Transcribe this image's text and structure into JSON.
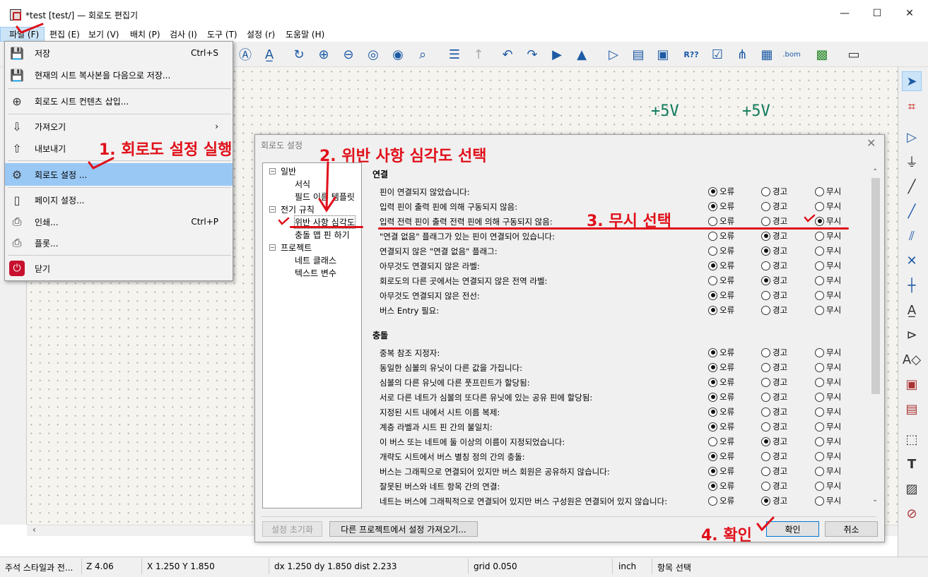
{
  "window": {
    "title": "*test [test/] — 회로도 편집기",
    "controls": {
      "minimize": "—",
      "maximize": "☐",
      "close": "✕"
    }
  },
  "menubar": [
    "파일 (F)",
    "편집 (E)",
    "보기 (V)",
    "배치 (P)",
    "검사 (I)",
    "도구 (T)",
    "설정 (r)",
    "도움말 (H)"
  ],
  "file_menu": {
    "items": [
      {
        "label": "저장",
        "shortcut": "Ctrl+S",
        "icon": "save-icon"
      },
      {
        "label": "현재의 시트 복사본을 다음으로 저장...",
        "icon": "save-copy-icon"
      },
      {
        "label": "회로도 시트 컨텐츠 삽입...",
        "icon": "insert-sheet-icon"
      },
      {
        "label": "가져오기",
        "submenu": "›",
        "icon": "import-icon"
      },
      {
        "label": "내보내기",
        "icon": "export-icon"
      },
      {
        "label": "회로도 설정 ...",
        "icon": "schematic-setup-icon",
        "highlighted": true
      },
      {
        "label": "페이지 설정...",
        "icon": "page-setup-icon"
      },
      {
        "label": "인쇄...",
        "shortcut": "Ctrl+P",
        "icon": "print-icon"
      },
      {
        "label": "플롯...",
        "icon": "plot-icon"
      },
      {
        "label": "닫기",
        "icon": "power-icon"
      }
    ]
  },
  "canvas": {
    "power_labels": [
      "+5V",
      "+5V"
    ]
  },
  "dialog": {
    "title": "회로도 설정",
    "tree": [
      {
        "label": "일반",
        "expander": "−",
        "level": 0
      },
      {
        "label": "서식",
        "level": 1
      },
      {
        "label": "필드 이름 템플릿",
        "level": 1
      },
      {
        "label": "전기 규칙",
        "expander": "−",
        "level": 0
      },
      {
        "label": "위반 사항 심각도",
        "level": 1,
        "selected": true
      },
      {
        "label": "충돌 맵 핀 하기",
        "level": 1
      },
      {
        "label": "프로젝트",
        "expander": "−",
        "level": 0
      },
      {
        "label": "네트 클래스",
        "level": 1
      },
      {
        "label": "텍스트 변수",
        "level": 1
      }
    ],
    "option_labels": {
      "error": "오류",
      "warning": "경고",
      "ignore": "무시"
    },
    "sections": [
      {
        "title": "연결",
        "rows": [
          {
            "label": "핀이 연결되지 않았습니다:",
            "selected": "error"
          },
          {
            "label": "입력 핀이 출력 핀에 의해 구동되지 않음:",
            "selected": "error"
          },
          {
            "label": "입력 전력 핀이 출력 전력 핀에 의해 구동되지 않음:",
            "selected": "ignore"
          },
          {
            "label": "\"연결 없음\" 플래그가 있는 핀이 연결되어 있습니다:",
            "selected": "warning"
          },
          {
            "label": "연결되지 않은 \"연결 없음\" 플래그:",
            "selected": "warning"
          },
          {
            "label": "아무것도 연결되지 않은 라벨:",
            "selected": "error"
          },
          {
            "label": "회로도의 다른 곳에서는 연결되지 않은 전역 라벨:",
            "selected": "warning"
          },
          {
            "label": "아무것도 연결되지 않은 전선:",
            "selected": "error"
          },
          {
            "label": "버스 Entry 필요:",
            "selected": "error"
          }
        ]
      },
      {
        "title": "충돌",
        "rows": [
          {
            "label": "중복 참조 지정자:",
            "selected": "error"
          },
          {
            "label": "동일한 심볼의 유닛이 다른 값을 가집니다:",
            "selected": "error"
          },
          {
            "label": "심볼의 다른 유닛에 다른 풋프린트가 할당됨:",
            "selected": "error"
          },
          {
            "label": "서로 다른 네트가 심볼의 또다른 유닛에 있는 공유 핀에 할당됨:",
            "selected": "error"
          },
          {
            "label": "지정된 시트 내에서 시트 이름 복제:",
            "selected": "error"
          },
          {
            "label": "계층 라벨과 시트 핀 간의 불일치:",
            "selected": "error"
          },
          {
            "label": "이 버스 또는 네트에 둘 이상의 이름이 지정되었습니다:",
            "selected": "warning"
          },
          {
            "label": "개략도 시트에서 버스 별칭 정의 간의 충돌:",
            "selected": "error"
          },
          {
            "label": "버스는 그래픽으로 연결되어 있지만 버스 회원은 공유하지 않습니다:",
            "selected": "error"
          },
          {
            "label": "잘못된 버스와 네트 항목 간의 연결:",
            "selected": "error"
          },
          {
            "label": "네트는 버스에 그래픽적으로 연결되어 있지만 버스 구성원은 연결되어 있지 않습니다:",
            "selected": "warning"
          }
        ]
      }
    ],
    "buttons": {
      "reset": "설정 초기화",
      "import": "다른 프로젝트에서 설정 가져오기...",
      "ok": "확인",
      "cancel": "취소"
    }
  },
  "annotations": {
    "step1": "1. 회로도 설정 실행",
    "step2": "2. 위반 사항 심각도 선택",
    "step3": "3. 무시 선택",
    "step4": "4. 확인"
  },
  "statusbar": {
    "hint": "주석 스타일과 전...",
    "zoom": "Z 4.06",
    "coords": "X 1.250  Y 1.850",
    "delta": "dx 1.250  dy 1.850  dist 2.233",
    "grid": "grid 0.050",
    "units": "inch",
    "mode": "항목 선택"
  },
  "colors": {
    "annotation": "#e0101a",
    "power_symbol": "#0f7a5b",
    "menu_highlight": "#99c8f5"
  }
}
